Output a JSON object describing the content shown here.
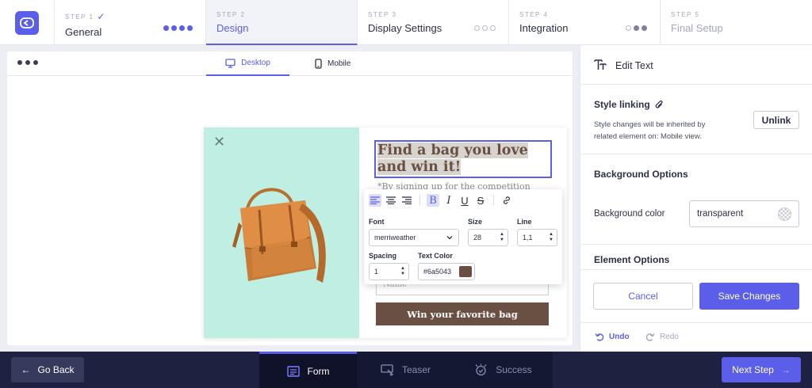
{
  "steps": [
    {
      "num": "STEP 1",
      "name": "General",
      "done": true
    },
    {
      "num": "STEP 2",
      "name": "Design"
    },
    {
      "num": "STEP 3",
      "name": "Display Settings"
    },
    {
      "num": "STEP 4",
      "name": "Integration"
    },
    {
      "num": "STEP 5",
      "name": "Final Setup"
    }
  ],
  "view_tabs": {
    "desktop": "Desktop",
    "mobile": "Mobile"
  },
  "popup": {
    "headline_line1": "Find a bag you love",
    "headline_line2": "and win it!",
    "subtext": "*By signing up for the competition",
    "name_placeholder": "Name",
    "cta": "Win your favorite bag",
    "accent_color": "#6a5043",
    "image_bg_color": "#bfeee2"
  },
  "text_toolbar": {
    "font_label": "Font",
    "font_value": "merriweather",
    "size_label": "Size",
    "size_value": "28",
    "line_label": "Line",
    "line_value": "1,1",
    "spacing_label": "Spacing",
    "spacing_value": "1",
    "text_color_label": "Text Color",
    "text_color_value": "#6a5043"
  },
  "side": {
    "title": "Edit Text",
    "style_linking_title": "Style linking",
    "style_linking_desc_1": "Style changes will be inherited by",
    "style_linking_desc_2": "related element on: Mobile view.",
    "unlink": "Unlink",
    "bg_options_title": "Background Options",
    "bg_color_label": "Background color",
    "bg_color_value": "transparent",
    "element_options_title": "Element Options",
    "cancel": "Cancel",
    "save": "Save Changes",
    "undo": "Undo",
    "redo": "Redo"
  },
  "bottom": {
    "go_back": "Go Back",
    "tabs": [
      "Form",
      "Teaser",
      "Success"
    ],
    "next_step": "Next Step"
  },
  "colors": {
    "accent": "#5a5ee8",
    "dark_bar": "#1e2140"
  }
}
